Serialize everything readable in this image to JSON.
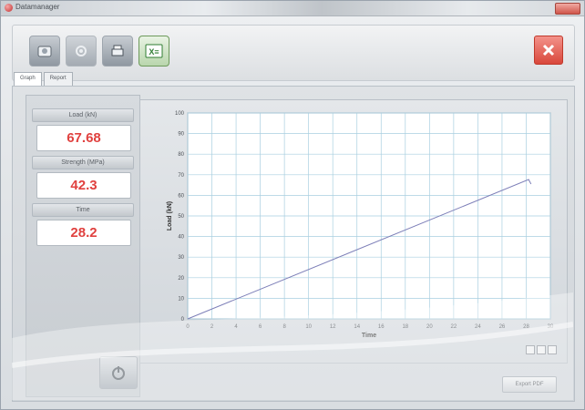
{
  "window": {
    "title": "Datamanager"
  },
  "toolbar": {
    "buttons": [
      {
        "icon": "machine-icon"
      },
      {
        "icon": "settings-icon"
      },
      {
        "icon": "print-icon"
      },
      {
        "icon": "excel-icon",
        "label": "X≡"
      }
    ]
  },
  "tabs": [
    "Graph",
    "Report"
  ],
  "readouts": [
    {
      "label": "Load (kN)",
      "value": "67.68"
    },
    {
      "label": "Strength (MPa)",
      "value": "42.3"
    },
    {
      "label": "Time",
      "value": "28.2"
    }
  ],
  "colors": {
    "value_text": "#e0413f",
    "series": "#7d7fb8",
    "grid": "#a9cfe0"
  },
  "chart_data": {
    "type": "line",
    "xlabel": "Time",
    "ylabel": "Load (kN)",
    "xlim": [
      0,
      30
    ],
    "ylim": [
      0,
      100
    ],
    "x_ticks": [
      0,
      2,
      4,
      6,
      8,
      10,
      12,
      14,
      16,
      18,
      20,
      22,
      24,
      26,
      28,
      30
    ],
    "y_ticks": [
      0,
      10,
      20,
      30,
      40,
      50,
      60,
      70,
      80,
      90,
      100
    ],
    "grid": true,
    "series": [
      {
        "x": [
          0,
          28.2,
          28.4
        ],
        "y": [
          0,
          67.68,
          65.5
        ]
      }
    ]
  },
  "bottom": {
    "export_label": "Export PDF"
  }
}
